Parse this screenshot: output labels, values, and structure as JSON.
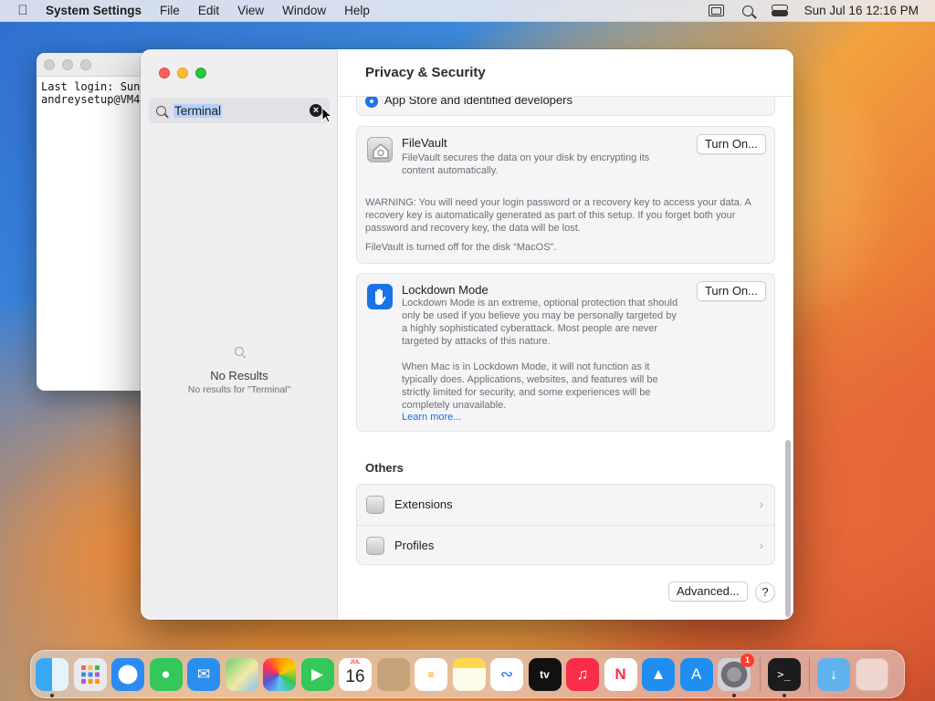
{
  "menubar": {
    "app_name": "System Settings",
    "menus": [
      "File",
      "Edit",
      "View",
      "Window",
      "Help"
    ],
    "datetime": "Sun Jul 16  12:16 PM",
    "icons": [
      "window-icon",
      "search-icon",
      "control-center-icon"
    ]
  },
  "terminal": {
    "lines": [
      "Last login: Sun",
      "andreysetup@VM4"
    ]
  },
  "sidebar": {
    "search": {
      "value": "Terminal"
    },
    "no_results": {
      "title": "No Results",
      "subtitle": "No results for \"Terminal\""
    }
  },
  "main": {
    "title": "Privacy & Security",
    "radio_option": "App Store and identified developers",
    "filevault": {
      "title": "FileVault",
      "description": "FileVault secures the data on your disk by encrypting its content automatically.",
      "warning": "WARNING: You will need your login password or a recovery key to access your data. A recovery key is automatically generated as part of this setup. If you forget both your password and recovery key, the data will be lost.",
      "status": "FileVault is turned off for the disk “MacOS”.",
      "button": "Turn On..."
    },
    "lockdown": {
      "title": "Lockdown Mode",
      "description": "Lockdown Mode is an extreme, optional protection that should only be used if you believe you may be personally targeted by a highly sophisticated cyberattack. Most people are never targeted by attacks of this nature.",
      "description2": "When Mac is in Lockdown Mode, it will not function as it typically does. Applications, websites, and features will be strictly limited for security, and some experiences will be completely unavailable.",
      "link": "Learn more...",
      "button": "Turn On..."
    },
    "others": {
      "title": "Others",
      "items": [
        "Extensions",
        "Profiles"
      ]
    },
    "advanced_button": "Advanced...",
    "help_button": "?"
  },
  "dock": {
    "apps": [
      "Finder",
      "Launchpad",
      "Safari",
      "Messages",
      "Mail",
      "Maps",
      "Photos",
      "FaceTime",
      "Calendar",
      "Contacts",
      "Reminders",
      "Notes",
      "Freeform",
      "TV",
      "Music",
      "News",
      "Keynote",
      "App Store",
      "System Settings",
      "Terminal",
      "Downloads",
      "Trash"
    ],
    "calendar_month": "JUL",
    "calendar_day": "16",
    "settings_badge": "1",
    "tv_label": "tv"
  },
  "colors": {
    "accent": "#1f74e9",
    "close": "#fe5f57",
    "minimize": "#febc2e",
    "zoom": "#28c840"
  }
}
